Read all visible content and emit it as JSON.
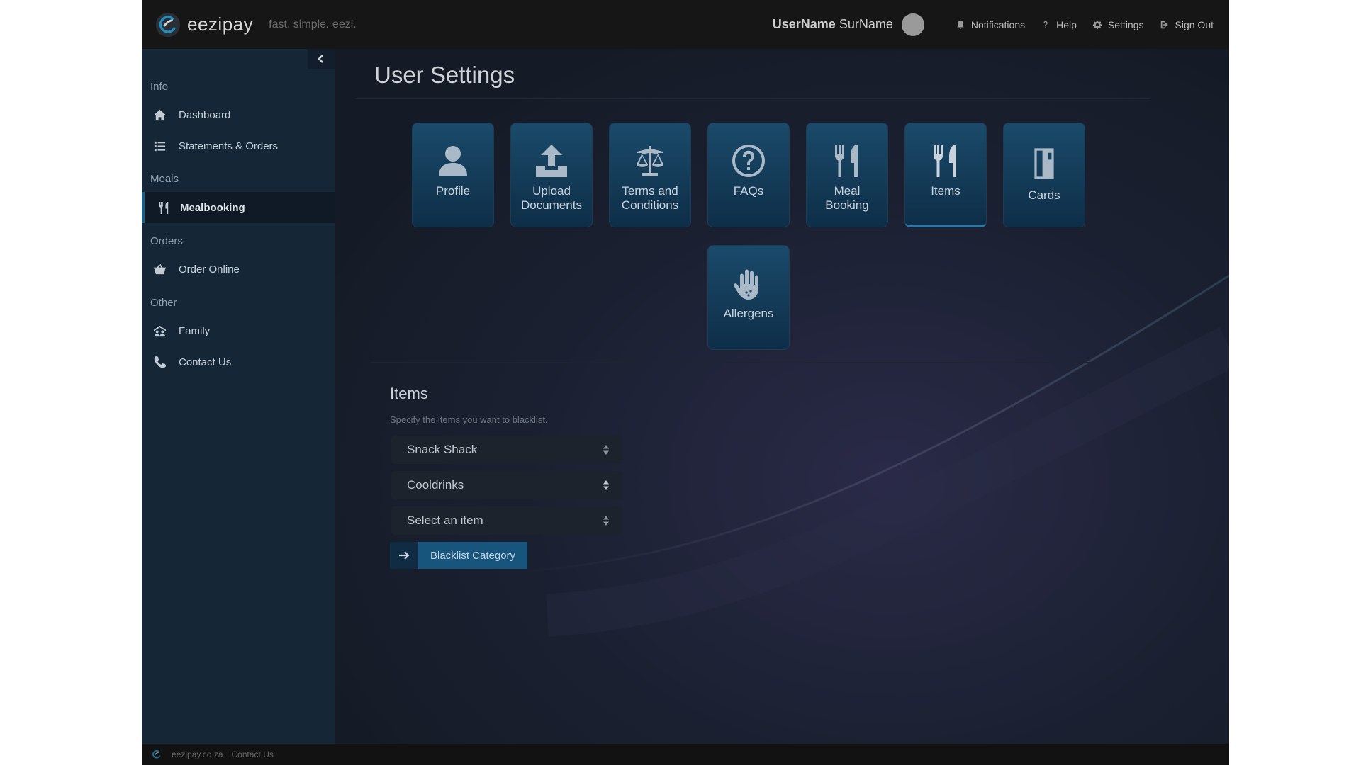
{
  "header": {
    "brand": "eezipay",
    "tagline": "fast. simple. eezi.",
    "user_first": "UserName",
    "user_last": "SurName",
    "links": {
      "notifications": "Notifications",
      "help": "Help",
      "settings": "Settings",
      "sign_out": "Sign Out"
    }
  },
  "sidebar": {
    "sections": {
      "info": "Info",
      "meals": "Meals",
      "orders": "Orders",
      "other": "Other"
    },
    "items": {
      "dashboard": "Dashboard",
      "statements": "Statements & Orders",
      "mealbooking": "Mealbooking",
      "order_online": "Order Online",
      "family": "Family",
      "contact": "Contact Us"
    },
    "active": "mealbooking"
  },
  "main": {
    "title": "User Settings",
    "tiles": {
      "profile": "Profile",
      "upload_1": "Upload",
      "upload_2": "Documents",
      "terms_1": "Terms and",
      "terms_2": "Conditions",
      "faqs": "FAQs",
      "meal_1": "Meal",
      "meal_2": "Booking",
      "items": "Items",
      "cards": "Cards",
      "allergens": "Allergens"
    },
    "selected_tile": "items",
    "items_section": {
      "title": "Items",
      "description": "Specify the items you want to blacklist.",
      "select_location": "Snack Shack",
      "select_category": "Cooldrinks",
      "select_item": "Select an item",
      "button": "Blacklist Category"
    }
  },
  "footer": {
    "site": "eezipay.co.za",
    "contact": "Contact Us"
  },
  "colors": {
    "accent": "#17557c",
    "sidebar": "#152737",
    "header": "#161616",
    "background": "#151b26"
  }
}
